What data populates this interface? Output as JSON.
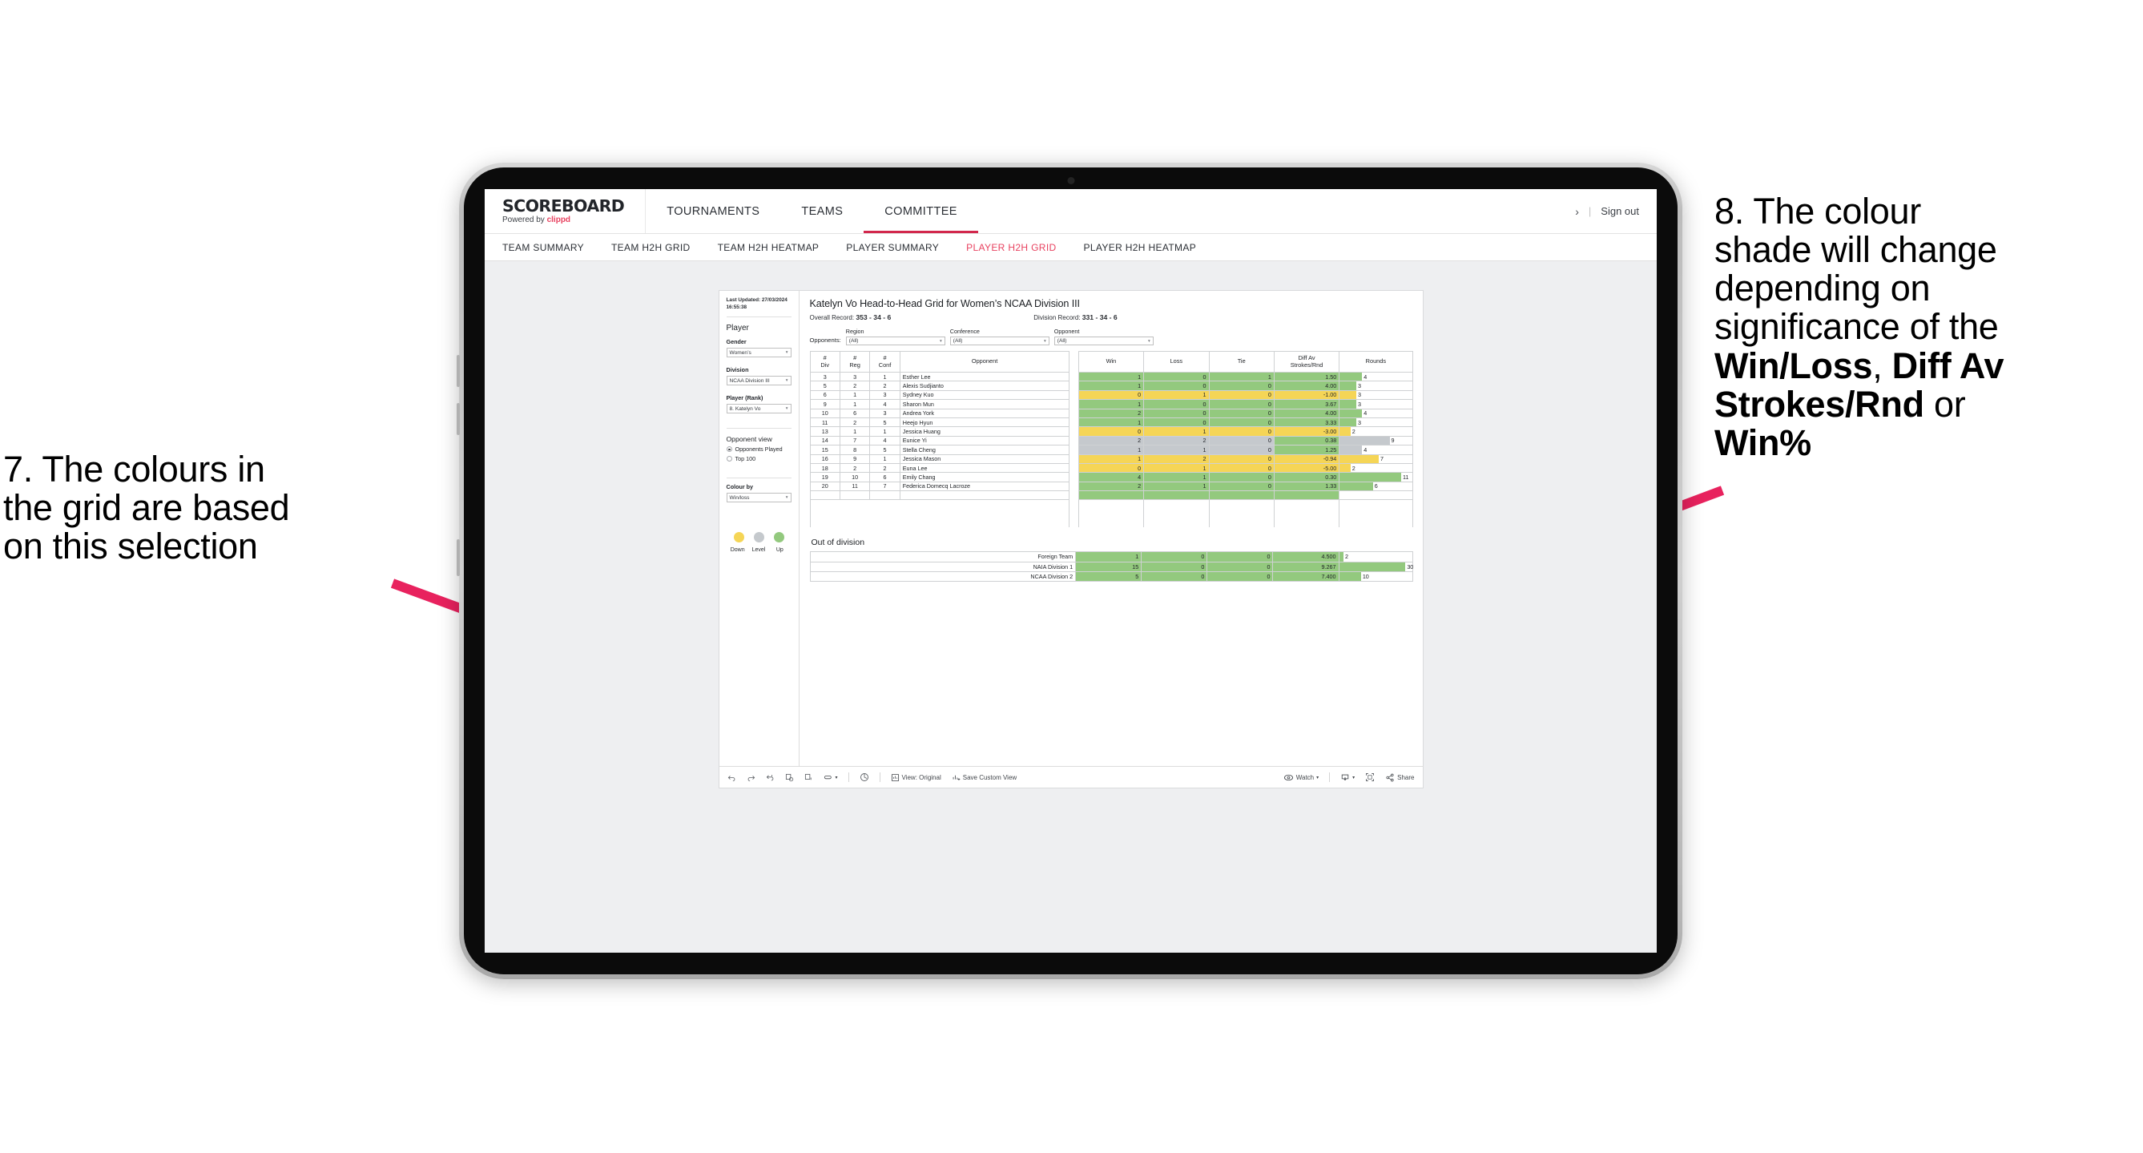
{
  "annotations": {
    "left": {
      "line1": "7. The colours in",
      "line2": "the grid are based",
      "line3": "on this selection"
    },
    "right": {
      "line1": "8. The colour",
      "line2": "shade will change",
      "line3": "depending on",
      "line4": "significance of the",
      "bold1": "Win/Loss",
      "sep1": ", ",
      "bold2": "Diff Av Strokes/Rnd",
      "tail": " or ",
      "bold3": "Win%"
    },
    "arrow_color": "#e8225e"
  },
  "header": {
    "brand_title": "SCOREBOARD",
    "brand_sub_prefix": "Powered by ",
    "brand_sub_name": "clippd",
    "nav": [
      {
        "label": "TOURNAMENTS",
        "active": false
      },
      {
        "label": "TEAMS",
        "active": false
      },
      {
        "label": "COMMITTEE",
        "active": true
      }
    ],
    "chevron": "›",
    "divider": "|",
    "sign_out": "Sign out"
  },
  "subnav": [
    {
      "label": "TEAM SUMMARY",
      "active": false
    },
    {
      "label": "TEAM H2H GRID",
      "active": false
    },
    {
      "label": "TEAM H2H HEATMAP",
      "active": false
    },
    {
      "label": "PLAYER SUMMARY",
      "active": false
    },
    {
      "label": "PLAYER H2H GRID",
      "active": true
    },
    {
      "label": "PLAYER H2H HEATMAP",
      "active": false
    }
  ],
  "sidebar": {
    "last_updated": "Last Updated: 27/03/2024 16:55:38",
    "player_heading": "Player",
    "gender_label": "Gender",
    "gender_value": "Women’s",
    "division_label": "Division",
    "division_value": "NCAA Division III",
    "player_rank_label": "Player (Rank)",
    "player_rank_value": "8. Katelyn Vo",
    "opponent_view_heading": "Opponent view",
    "opponent_view_options": [
      {
        "label": "Opponents Played",
        "selected": true
      },
      {
        "label": "Top 100",
        "selected": false
      }
    ],
    "colour_by_label": "Colour by",
    "colour_by_value": "Win/loss",
    "legend": [
      {
        "label": "Down",
        "color": "#f5d556"
      },
      {
        "label": "Level",
        "color": "#c5c9cd"
      },
      {
        "label": "Up",
        "color": "#93c97e"
      }
    ],
    "caret": "▾"
  },
  "main": {
    "title": "Katelyn Vo Head-to-Head Grid for Women’s NCAA Division III",
    "overall_record_label": "Overall Record:",
    "overall_record_value": "353 - 34 - 6",
    "division_record_label": "Division Record:",
    "division_record_value": "331 - 34 - 6",
    "opponents_label": "Opponents:",
    "filters": [
      {
        "label": "Region",
        "value": "(All)"
      },
      {
        "label": "Conference",
        "value": "(All)"
      },
      {
        "label": "Opponent",
        "value": "(All)"
      }
    ],
    "out_of_division_title": "Out of division"
  },
  "chart_data": {
    "type": "table",
    "title": "Katelyn Vo Head-to-Head Grid for Women’s NCAA Division III",
    "columns": [
      "# Div",
      "# Reg",
      "# Conf",
      "Opponent",
      "Win",
      "Loss",
      "Tie",
      "Diff Av Strokes/Rnd",
      "Rounds"
    ],
    "header_lines": {
      "div": [
        "#",
        "Div"
      ],
      "reg": [
        "#",
        "Reg"
      ],
      "conf": [
        "#",
        "Conf"
      ],
      "opponent": [
        "Opponent"
      ],
      "win": [
        "Win"
      ],
      "loss": [
        "Loss"
      ],
      "tie": [
        "Tie"
      ],
      "diff": [
        "Diff Av",
        "Strokes/Rnd"
      ],
      "rounds": [
        "Rounds"
      ]
    },
    "rounds_max": 13,
    "rows": [
      {
        "div": "3",
        "reg": "3",
        "conf": "1",
        "opponent": "Esther Lee",
        "win": "1",
        "loss": "0",
        "tie": "1",
        "diff": "1.50",
        "rounds": "4",
        "rounds_n": 4,
        "color": "#93c97e"
      },
      {
        "div": "5",
        "reg": "2",
        "conf": "2",
        "opponent": "Alexis Sudjianto",
        "win": "1",
        "loss": "0",
        "tie": "0",
        "diff": "4.00",
        "rounds": "3",
        "rounds_n": 3,
        "color": "#93c97e"
      },
      {
        "div": "6",
        "reg": "1",
        "conf": "3",
        "opponent": "Sydney Kuo",
        "win": "0",
        "loss": "1",
        "tie": "0",
        "diff": "-1.00",
        "rounds": "3",
        "rounds_n": 3,
        "color": "#f5d556"
      },
      {
        "div": "9",
        "reg": "1",
        "conf": "4",
        "opponent": "Sharon Mun",
        "win": "1",
        "loss": "0",
        "tie": "0",
        "diff": "3.67",
        "rounds": "3",
        "rounds_n": 3,
        "color": "#93c97e"
      },
      {
        "div": "10",
        "reg": "6",
        "conf": "3",
        "opponent": "Andrea York",
        "win": "2",
        "loss": "0",
        "tie": "0",
        "diff": "4.00",
        "rounds": "4",
        "rounds_n": 4,
        "color": "#93c97e"
      },
      {
        "div": "11",
        "reg": "2",
        "conf": "5",
        "opponent": "Heejo Hyun",
        "win": "1",
        "loss": "0",
        "tie": "0",
        "diff": "3.33",
        "rounds": "3",
        "rounds_n": 3,
        "color": "#93c97e"
      },
      {
        "div": "13",
        "reg": "1",
        "conf": "1",
        "opponent": "Jessica Huang",
        "win": "0",
        "loss": "1",
        "tie": "0",
        "diff": "-3.00",
        "rounds": "2",
        "rounds_n": 2,
        "color": "#f5d556"
      },
      {
        "div": "14",
        "reg": "7",
        "conf": "4",
        "opponent": "Eunice Yi",
        "win": "2",
        "loss": "2",
        "tie": "0",
        "diff": "0.38",
        "rounds": "9",
        "rounds_n": 9,
        "color": "#c5c9cd",
        "diff_color": "#93c97e"
      },
      {
        "div": "15",
        "reg": "8",
        "conf": "5",
        "opponent": "Stella Cheng",
        "win": "1",
        "loss": "1",
        "tie": "0",
        "diff": "1.25",
        "rounds": "4",
        "rounds_n": 4,
        "color": "#c5c9cd",
        "diff_color": "#93c97e"
      },
      {
        "div": "16",
        "reg": "9",
        "conf": "1",
        "opponent": "Jessica Mason",
        "win": "1",
        "loss": "2",
        "tie": "0",
        "diff": "-0.94",
        "rounds": "7",
        "rounds_n": 7,
        "color": "#f5d556"
      },
      {
        "div": "18",
        "reg": "2",
        "conf": "2",
        "opponent": "Euna Lee",
        "win": "0",
        "loss": "1",
        "tie": "0",
        "diff": "-5.00",
        "rounds": "2",
        "rounds_n": 2,
        "color": "#f5d556"
      },
      {
        "div": "19",
        "reg": "10",
        "conf": "6",
        "opponent": "Emily Chang",
        "win": "4",
        "loss": "1",
        "tie": "0",
        "diff": "0.30",
        "rounds": "11",
        "rounds_n": 11,
        "color": "#93c97e"
      },
      {
        "div": "20",
        "reg": "11",
        "conf": "7",
        "opponent": "Federica Domecq Lacroze",
        "win": "2",
        "loss": "1",
        "tie": "0",
        "diff": "1.33",
        "rounds": "6",
        "rounds_n": 6,
        "color": "#93c97e"
      }
    ],
    "out_of_division": {
      "rounds_max": 33,
      "rows": [
        {
          "name": "Foreign Team",
          "win": "1",
          "loss": "0",
          "tie": "0",
          "diff": "4.500",
          "rounds": "2",
          "rounds_n": 2,
          "color": "#93c97e"
        },
        {
          "name": "NAIA Division 1",
          "win": "15",
          "loss": "0",
          "tie": "0",
          "diff": "9.267",
          "rounds": "30",
          "rounds_n": 30,
          "color": "#93c97e"
        },
        {
          "name": "NCAA Division 2",
          "win": "5",
          "loss": "0",
          "tie": "0",
          "diff": "7.400",
          "rounds": "10",
          "rounds_n": 10,
          "color": "#93c97e"
        }
      ]
    }
  },
  "toolbar": {
    "view_label": "View: Original",
    "save_label": "Save Custom View",
    "watch_label": "Watch",
    "share_label": "Share",
    "caret": "▾"
  }
}
